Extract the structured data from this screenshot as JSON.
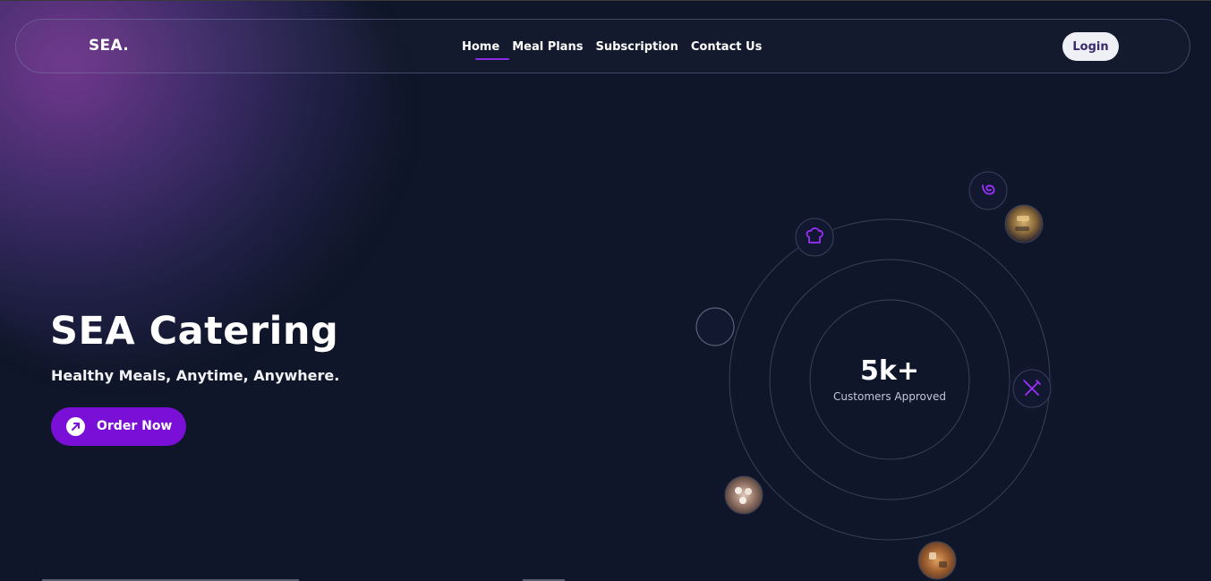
{
  "brand": {
    "logo": "SEA."
  },
  "nav": {
    "links": [
      "Home",
      "Meal Plans",
      "Subscription",
      "Contact Us"
    ],
    "active": "Home",
    "login_label": "Login"
  },
  "hero": {
    "title": "SEA Catering",
    "subtitle": "Healthy Meals, Anytime, Anywhere.",
    "cta_label": "Order Now"
  },
  "stat": {
    "value": "5k+",
    "label": "Customers Approved"
  },
  "orbit_items": [
    {
      "kind": "icon",
      "icon": "leaf-swirl-icon"
    },
    {
      "kind": "image",
      "icon": "food-photo-skewers"
    },
    {
      "kind": "icon",
      "icon": "chef-hat-icon"
    },
    {
      "kind": "empty",
      "icon": ""
    },
    {
      "kind": "icon",
      "icon": "utensils-crossed-icon"
    },
    {
      "kind": "image",
      "icon": "food-photo-sushi"
    },
    {
      "kind": "image",
      "icon": "food-photo-platter"
    }
  ],
  "colors": {
    "background": "#101629",
    "accent": "#7a10d8",
    "accent_icon": "#9b30ff",
    "ring": "#3a4057",
    "text": "#ffffff"
  }
}
